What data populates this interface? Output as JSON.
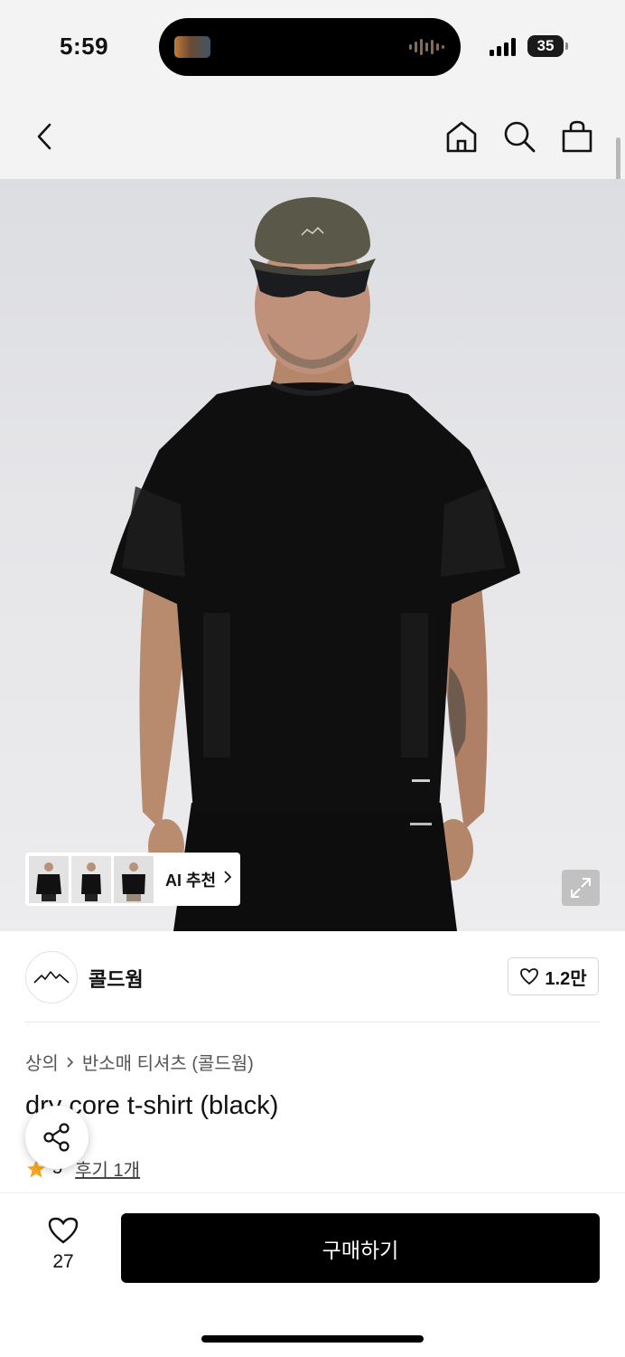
{
  "status_bar": {
    "time": "5:59",
    "battery": "35"
  },
  "product": {
    "breadcrumb": [
      "상의",
      "반소매 티셔츠 (콜드웜)"
    ],
    "title": "dry core t-shirt (black)",
    "rating": "5",
    "review_link": "후기 1개"
  },
  "brand": {
    "name": "콜드웜",
    "like_count": "1.2만"
  },
  "ai_recommend": {
    "label": "AI 추천"
  },
  "bottom": {
    "wish_count": "27",
    "buy_label": "구매하기"
  },
  "colors": {
    "accent_star": "#f5a623",
    "buy_button": "#000000",
    "header_bg": "#f3f3f3"
  }
}
